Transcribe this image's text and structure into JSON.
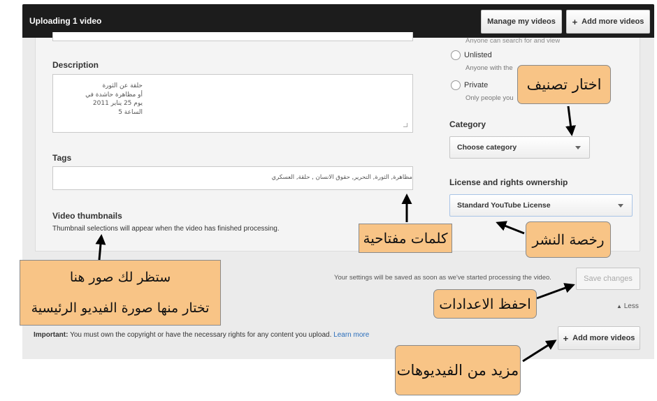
{
  "header": {
    "title": "Uploading 1 video",
    "manage_label": "Manage my videos",
    "add_more_label": "Add more videos"
  },
  "privacy": {
    "public_desc": "Anyone can search for and view",
    "unlisted_label": "Unlisted",
    "unlisted_desc": "Anyone with the",
    "private_label": "Private",
    "private_desc": "Only people you"
  },
  "description": {
    "label": "Description",
    "lines": [
      "حلقة عن الثورة",
      "أو مظاهرة حاشدة في",
      "يوم 25 يناير 2011",
      "الساعة 5"
    ]
  },
  "tags": {
    "label": "Tags",
    "value": "مظاهرة, الثورة, التحرير, حقوق الانسان , حلقة, العسكري"
  },
  "thumbnails": {
    "label": "Video thumbnails",
    "desc": "Thumbnail selections will appear when the video has finished processing."
  },
  "category": {
    "label": "Category",
    "selected": "Choose category"
  },
  "license": {
    "label": "License and rights ownership",
    "selected": "Standard YouTube License"
  },
  "save": {
    "note": "Your settings will be saved as soon as we've started processing the video.",
    "button_label": "Save changes",
    "less_label": "Less"
  },
  "footer": {
    "important_label": "Important:",
    "text": "You must own the copyright or have the necessary rights for any content you upload.",
    "learn_more": "Learn more",
    "add_more_label": "Add more videos"
  },
  "callouts": {
    "category": "اختار تصنيف",
    "tags": "كلمات مفتاحية",
    "license": "رخصة النشر",
    "thumbnails_line1": "ستظر لك صور هنا",
    "thumbnails_line2": "تختار منها صورة الفيديو الرئيسية",
    "save": "احفظ الاعدادات",
    "more_videos": "مزيد من الفيديوهات"
  },
  "colors": {
    "callout": "#f8c486",
    "topbar": "#1c1c1c",
    "link": "#2a6ebb"
  }
}
